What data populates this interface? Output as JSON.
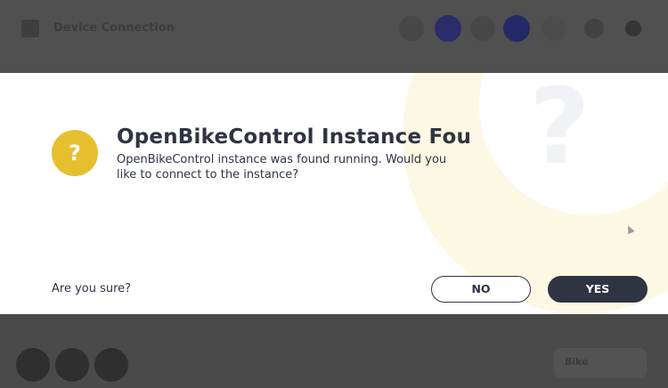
{
  "app": {
    "title": "Device Connection",
    "footer_select_label": "Bike"
  },
  "dialog": {
    "title": "OpenBikeControl Instance Found",
    "message": "OpenBikeControl instance was found running. Would you like to connect to the instance?",
    "confirm_prompt": "Are you sure?",
    "no_label": "NO",
    "yes_label": "YES",
    "badge_icon": "question-mark-icon",
    "badge_glyph": "?",
    "decor_glyph": "?"
  },
  "colors": {
    "accent": "#e6bf2f",
    "primary_dark": "#2e3442",
    "overlay": "#4a4a4a"
  }
}
